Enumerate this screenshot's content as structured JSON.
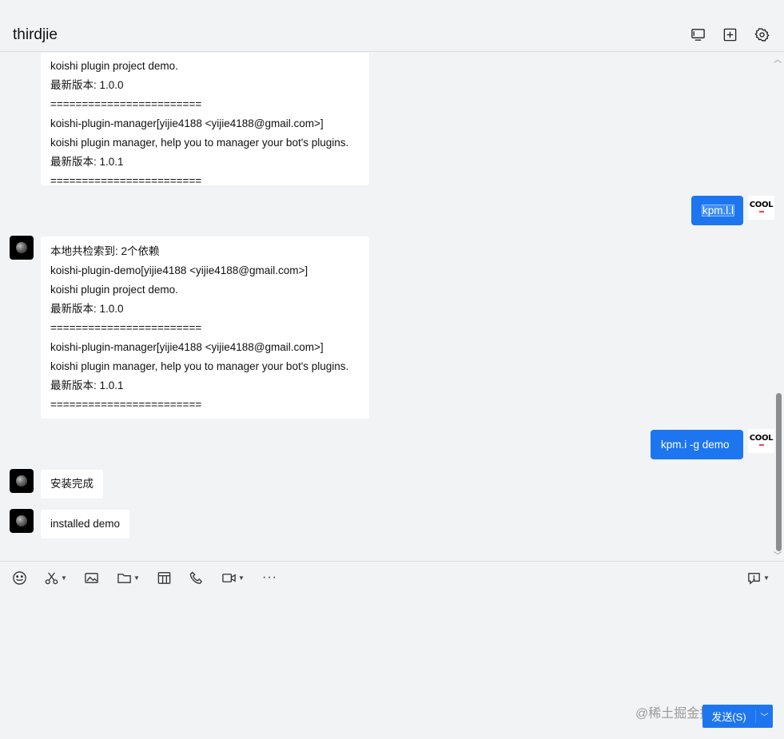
{
  "header": {
    "title": "thirdjie"
  },
  "messages": {
    "partial": {
      "lines": [
        "koishi plugin project demo.",
        "最新版本: 1.0.0",
        "========================",
        "koishi-plugin-manager[yijie4188 <yijie4188@gmail.com>]",
        "koishi plugin manager, help you to manager your bot's plugins.",
        "最新版本: 1.0.1",
        "========================"
      ]
    },
    "sent1": {
      "text": "kpm.l.l"
    },
    "reply1": {
      "lines": [
        "本地共检索到: 2个依赖",
        "koishi-plugin-demo[yijie4188 <yijie4188@gmail.com>]",
        "koishi plugin project demo.",
        "最新版本: 1.0.0",
        "========================",
        "koishi-plugin-manager[yijie4188 <yijie4188@gmail.com>]",
        "koishi plugin manager, help you to manager your bot's plugins.",
        "最新版本: 1.0.1",
        "========================"
      ]
    },
    "sent2": {
      "text": "kpm.i -g demo"
    },
    "reply2": {
      "text": "安装完成"
    },
    "reply3": {
      "text": "installed demo"
    }
  },
  "avatars": {
    "self_label": "COOL"
  },
  "toolbar": {
    "icons": [
      "emoji-icon",
      "scissors-icon",
      "image-icon",
      "folder-icon",
      "sticker-icon",
      "phone-icon",
      "video-icon",
      "more-icon",
      "chat-history-icon"
    ]
  },
  "send": {
    "label": "发送(S)"
  },
  "watermark": {
    "text": "@稀土掘金技术社区"
  },
  "colors": {
    "accent": "#1d76f0",
    "background": "#f2f3f5",
    "bubble": "#ffffff"
  }
}
